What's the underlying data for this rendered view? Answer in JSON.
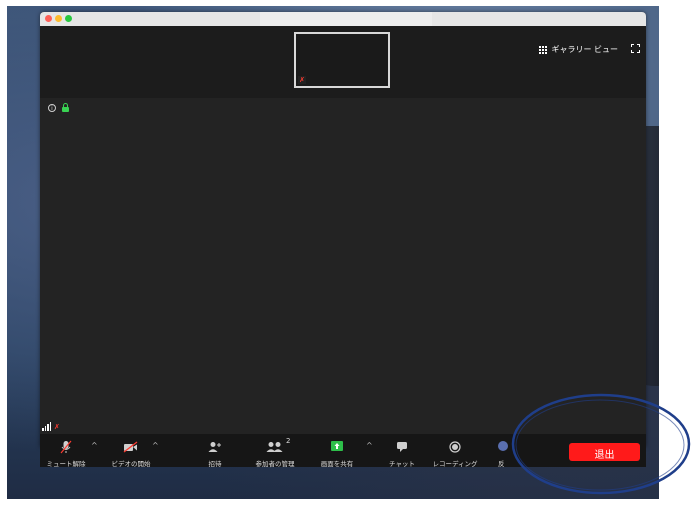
{
  "window": {
    "title": ""
  },
  "header": {
    "gallery_view_label": "ギャラリー ビュー"
  },
  "thumbnail": {
    "mic_state": "muted"
  },
  "toolbar": {
    "unmute_label": "ミュート解除",
    "start_video_label": "ビデオの開始",
    "invite_label": "招待",
    "participants_label": "参加者の管理",
    "participants_count": "2",
    "share_screen_label": "画面を共有",
    "chat_label": "チャット",
    "recording_label": "レコーディング",
    "reactions_label": "反",
    "leave_label": "退出"
  },
  "colors": {
    "leave_button": "#ff1a1a",
    "share_button": "#2dbf4a",
    "annotation_ellipse": "#1f3e8a"
  }
}
